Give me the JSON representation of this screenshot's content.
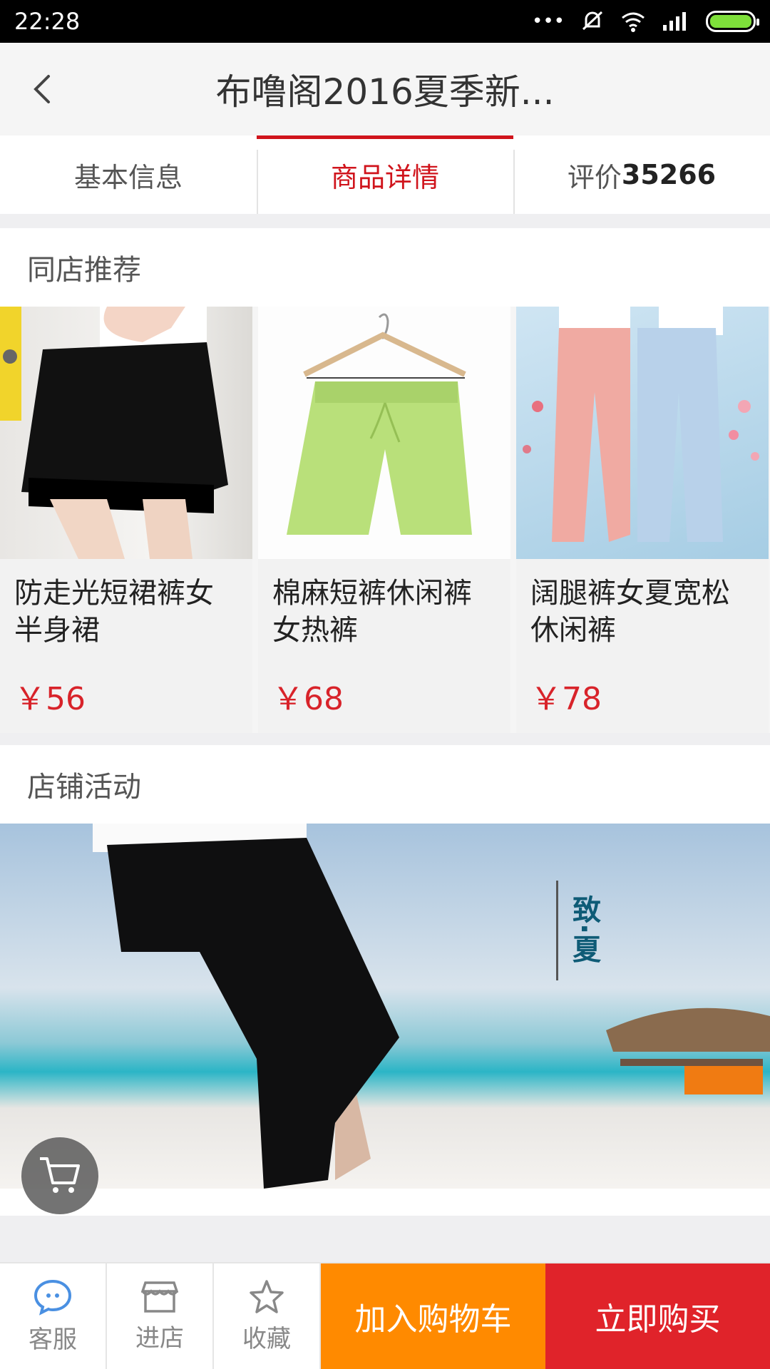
{
  "status_bar": {
    "time": "22:28"
  },
  "header": {
    "title": "布噜阁2016夏季新..."
  },
  "tabs": [
    {
      "label": "基本信息"
    },
    {
      "label": "商品详情"
    },
    {
      "label": "评价",
      "count": "35266"
    }
  ],
  "recommend": {
    "title": "同店推荐",
    "items": [
      {
        "name": "防走光短裙裤女半身裙",
        "price": "￥56"
      },
      {
        "name": "棉麻短裤休闲裤女热裤",
        "price": "￥68"
      },
      {
        "name": "阔腿裤女夏宽松休闲裤",
        "price": "￥78"
      }
    ]
  },
  "activity": {
    "title": "店铺活动",
    "banner_heading": "致·夏"
  },
  "bottom_bar": {
    "service": "客服",
    "shop": "进店",
    "favorite": "收藏",
    "add_to_cart": "加入购物车",
    "buy_now": "立即购买"
  },
  "colors": {
    "accent_red": "#d0141c",
    "cart_orange": "#ff8a00",
    "buy_red": "#e0232a",
    "price_red": "#d8232a"
  }
}
